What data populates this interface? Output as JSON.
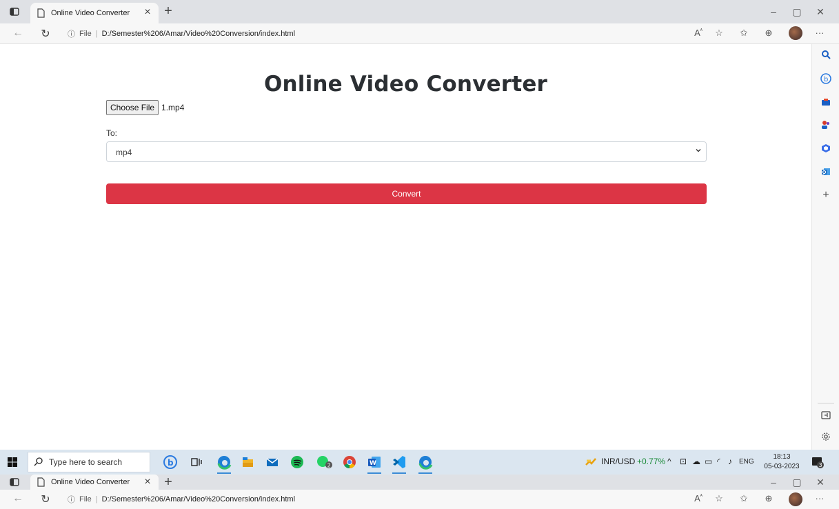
{
  "browser": {
    "tab_title": "Online Video Converter",
    "tab_close": "×",
    "new_tab": "+",
    "window_controls": {
      "minimize": "–",
      "restore": "▢",
      "close": "✕"
    },
    "address": {
      "scheme_label": "File",
      "separator": "|",
      "url": "D:/Semester%206/Amar/Video%20Conversion/index.html"
    },
    "toolbar_icons": [
      "read-aloud-icon",
      "add-favorite-icon",
      "favorites-icon",
      "collections-icon",
      "profile-avatar",
      "more-icon"
    ],
    "more_label": "···"
  },
  "page": {
    "title": "Online Video Converter",
    "file_input": {
      "button_label": "Choose File",
      "file_name": "1.mp4"
    },
    "to_label": "To:",
    "format_select": {
      "selected": "mp4"
    },
    "convert_label": "Convert"
  },
  "colors": {
    "convert": "#dc3545",
    "title": "#2b2f33"
  },
  "sidebar": {
    "icons": [
      "search-icon",
      "bing-icon",
      "shopping-icon",
      "people-icon",
      "office-icon",
      "outlook-icon",
      "add-icon"
    ],
    "add_label": "+",
    "bottom_icons": [
      "split-screen-icon",
      "settings-icon"
    ]
  },
  "taskbar": {
    "search_placeholder": "Type here to search",
    "apps": [
      "bing-app-icon",
      "task-view-icon",
      "edge-app-icon",
      "file-explorer-icon",
      "mail-icon",
      "spotify-icon",
      "whatsapp-icon",
      "chrome-icon",
      "word-icon",
      "vscode-icon",
      "edge-app-icon-2"
    ],
    "whatsapp_badge": "2",
    "ticker": {
      "symbol": "INR/USD",
      "change": "+0.77%"
    },
    "language": "ENG",
    "time": "18:13",
    "date": "05-03-2023",
    "notification_badge": "3"
  }
}
